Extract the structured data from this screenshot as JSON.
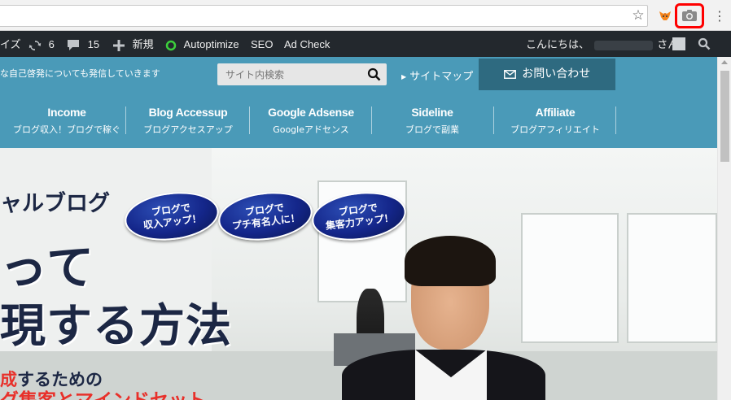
{
  "browser": {
    "icons": [
      "star-icon",
      "metamask-icon",
      "camera-icon",
      "menu-dots-icon"
    ]
  },
  "adminbar": {
    "customize_label": "イズ",
    "updates_count": "6",
    "comments_count": "15",
    "new_label": "新規",
    "autoptimize_label": "Autoptimize",
    "seo_label": "SEO",
    "adcheck_label": "Ad Check",
    "greeting_prefix": "こんにちは、",
    "greeting_suffix": "さん"
  },
  "header": {
    "tagline": "な自己啓発についても発信していきます",
    "search_placeholder": "サイト内検索",
    "sitemap_label": "サイトマップ",
    "contact_label": "お問い合わせ",
    "nav": [
      {
        "en": "Income",
        "jp": "ブログ収入！ブログで稼ぐ"
      },
      {
        "en": "Blog Accessup",
        "jp": "ブログアクセスアップ"
      },
      {
        "en": "Google Adsense",
        "jp": "Googleアドセンス"
      },
      {
        "en": "Sideline",
        "jp": "ブログで副業"
      },
      {
        "en": "Affiliate",
        "jp": "ブログアフィリエイト"
      }
    ]
  },
  "hero": {
    "line1": "ャルブログ",
    "line2": "って",
    "line3": "現する方法",
    "line4_red": "成",
    "line4_rest": "するための",
    "line5": "グ集客とマインドセット",
    "bubbles": [
      {
        "l1": "ブログで",
        "l2": "収入アップ！"
      },
      {
        "l1": "ブログで",
        "l2": "プチ有名人に！"
      },
      {
        "l1": "ブログで",
        "l2": "集客力アップ！"
      }
    ]
  },
  "colors": {
    "header_blue": "#4a9ab8",
    "contact_bg": "#2e6a80",
    "adminbar_bg": "#23282d",
    "highlight_red": "#ff0000",
    "hero_navy": "#1c2744"
  }
}
